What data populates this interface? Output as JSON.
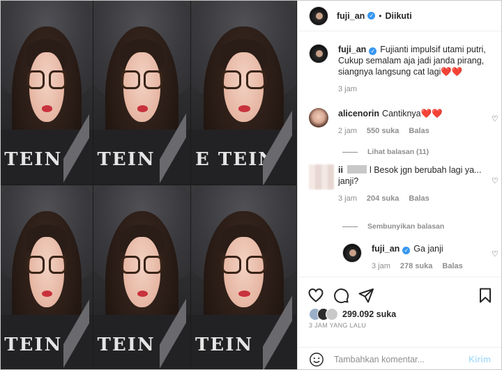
{
  "post": {
    "username": "fuji_an",
    "follow_status": "Diikuti",
    "caption": "Fujianti impulsif utami putri, Cukup semalam aja jadi janda pirang, siangnya langsung cat lagi❤️❤️",
    "caption_time": "3 jam",
    "photo_shirt_text": [
      "TEIN",
      "TEIN",
      "E TEIN",
      "TEIN",
      "TEIN",
      "TEIN"
    ]
  },
  "comments": [
    {
      "username": "alicenorin",
      "text": "Cantiknya❤️❤️",
      "time": "2 jam",
      "likes": "550 suka",
      "reply": "Balas"
    },
    {
      "username": "ii",
      "text": "l Besok jgn berubah lagi ya... janji?",
      "time": "3 jam",
      "likes": "204 suka",
      "reply": "Balas"
    }
  ],
  "threads": {
    "view_replies": "Lihat balasan (11)",
    "hide_replies": "Sembunyikan balasan"
  },
  "reply": {
    "username": "fuji_an",
    "text": "Ga janji",
    "time": "3 jam",
    "likes": "278 suka",
    "reply": "Balas"
  },
  "likes": {
    "count": "299.092 suka"
  },
  "time_ago": "3 JAM YANG LALU",
  "composer": {
    "placeholder": "Tambahkan komentar...",
    "post": "Kirim"
  },
  "icons": {
    "like": "heart-icon",
    "comment": "comment-icon",
    "share": "send-icon",
    "save": "bookmark-icon",
    "emoji": "emoji-icon",
    "verified": "verified-badge-icon"
  },
  "colors": {
    "verified": "#3897f0",
    "post_button": "#b2dffc",
    "muted_text": "#8e8e8e"
  }
}
